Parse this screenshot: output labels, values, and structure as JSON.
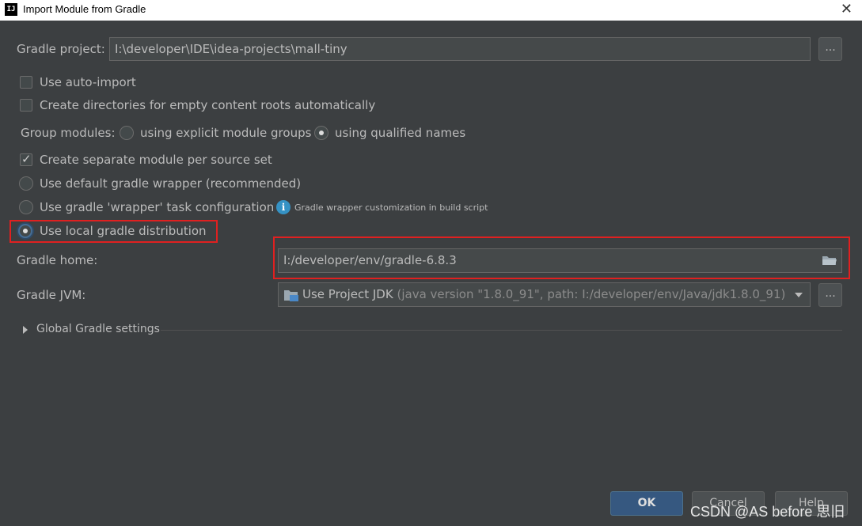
{
  "window": {
    "title": "Import Module from Gradle",
    "close_symbol": "✕"
  },
  "gradle_project": {
    "label": "Gradle project:",
    "value": "I:\\developer\\IDE\\idea-projects\\mall-tiny",
    "browse": "..."
  },
  "options": {
    "auto_import": {
      "label": "Use auto-import",
      "checked": false
    },
    "create_dirs": {
      "label": "Create directories for empty content roots automatically",
      "checked": false
    },
    "group_modules": {
      "label": "Group modules:",
      "option_explicit": "using explicit module groups",
      "option_qualified": "using qualified names",
      "selected": "using qualified names"
    },
    "separate_module": {
      "label": "Create separate module per source set",
      "checked": true
    },
    "default_wrapper": {
      "label": "Use default gradle wrapper (recommended)"
    },
    "wrapper_task": {
      "label": "Use gradle 'wrapper' task configuration",
      "hint": "Gradle wrapper customization in build script"
    },
    "local_distribution": {
      "label": "Use local gradle distribution",
      "selected": true
    }
  },
  "gradle_home": {
    "label": "Gradle home:",
    "value": "I:/developer/env/gradle-6.8.3"
  },
  "gradle_jvm": {
    "label": "Gradle JVM:",
    "value": "Use Project JDK",
    "detail": "(java version \"1.8.0_91\", path: I:/developer/env/Java/jdk1.8.0_91)",
    "browse": "..."
  },
  "global_settings": {
    "label": "Global Gradle settings"
  },
  "buttons": {
    "ok": "OK",
    "cancel": "Cancel",
    "help": "Help"
  },
  "watermark": "CSDN @AS before 思旧",
  "colors": {
    "accent": "#365880",
    "highlight": "#e02020",
    "background": "#3c3f41"
  }
}
